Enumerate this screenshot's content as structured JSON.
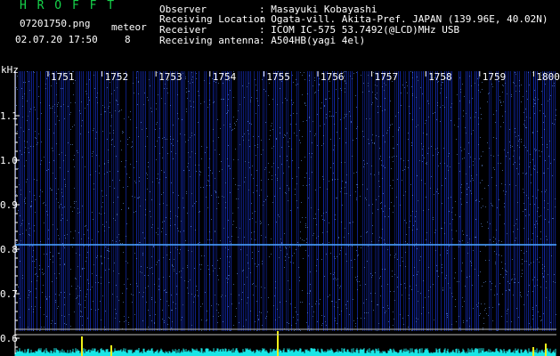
{
  "header": {
    "title": "H R O F F T",
    "filename": "07201750.png",
    "datetime": "02.07.20 17:50",
    "meteor_label": "meteor",
    "meteor_count": "8",
    "meta": [
      {
        "key": "Observer",
        "value": ": Masayuki Kobayashi"
      },
      {
        "key": "Receiving Location",
        "value": ": Ogata-vill. Akita-Pref. JAPAN (139.96E, 40.02N)"
      },
      {
        "key": "Receiver",
        "value": ": ICOM IC-575 53.7492(@LCD)MHz USB"
      },
      {
        "key": "Receiving antenna",
        "value": ": A504HB(yagi 4el)"
      }
    ]
  },
  "chart_data": {
    "type": "heatmap",
    "ylabel": "kHz",
    "y_ticks": [
      "1.1",
      "1.0",
      "0.9",
      "0.8",
      "0.7",
      "0.6"
    ],
    "x_ticks": [
      "1751",
      "1752",
      "1753",
      "1754",
      "1755",
      "1756",
      "1757",
      "1758",
      "1759",
      "1800"
    ],
    "carrier_khz": 0.81,
    "colors": {
      "background": "#000000",
      "noise": "#1a3cff",
      "signal": "#ffffff",
      "meter": "#19e6e6",
      "meter_peak": "#f0f018"
    }
  }
}
